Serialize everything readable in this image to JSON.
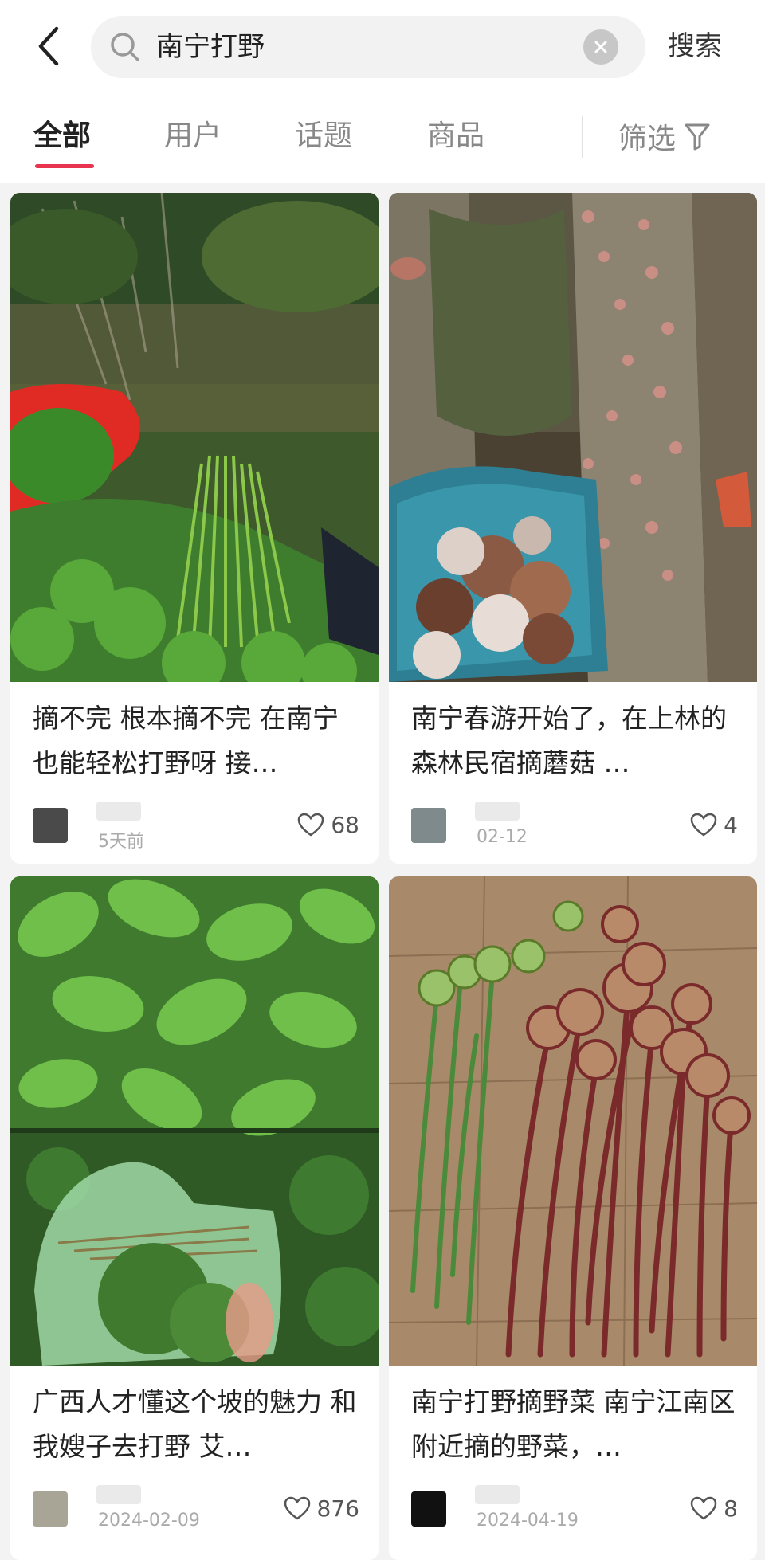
{
  "search": {
    "query": "南宁打野",
    "button_label": "搜索"
  },
  "tabs": [
    {
      "label": "全部",
      "active": true
    },
    {
      "label": "用户",
      "active": false
    },
    {
      "label": "话题",
      "active": false
    },
    {
      "label": "商品",
      "active": false
    }
  ],
  "filter": {
    "label": "筛选",
    "icon": "filter-icon"
  },
  "colors": {
    "accent": "#e8344e"
  },
  "cards": [
    {
      "title": "摘不完 根本摘不完 在南宁也能轻松打野呀 接…",
      "date": "5天前",
      "likes": "68",
      "avatar_color": "#4a4a4a",
      "image": "ferns-and-greens-with-red-bag"
    },
    {
      "title": "南宁春游开始了，在上林的森林民宿摘蘑菇 …",
      "date": "02-12",
      "likes": "4",
      "avatar_color": "#7e8a8c",
      "image": "mushrooms-in-blue-basin-by-logs"
    },
    {
      "title": "广西人才懂这个坡的魅力 和我嫂子去打野 艾…",
      "date": "2024-02-09",
      "likes": "876",
      "avatar_color": "#a9a596",
      "image": "wild-greens-in-plastic-bag"
    },
    {
      "title": "南宁打野摘野菜 南宁江南区附近摘的野菜，…",
      "date": "2024-04-19",
      "likes": "8",
      "avatar_color": "#111111",
      "image": "red-fern-fiddleheads-on-wood-floor"
    }
  ]
}
